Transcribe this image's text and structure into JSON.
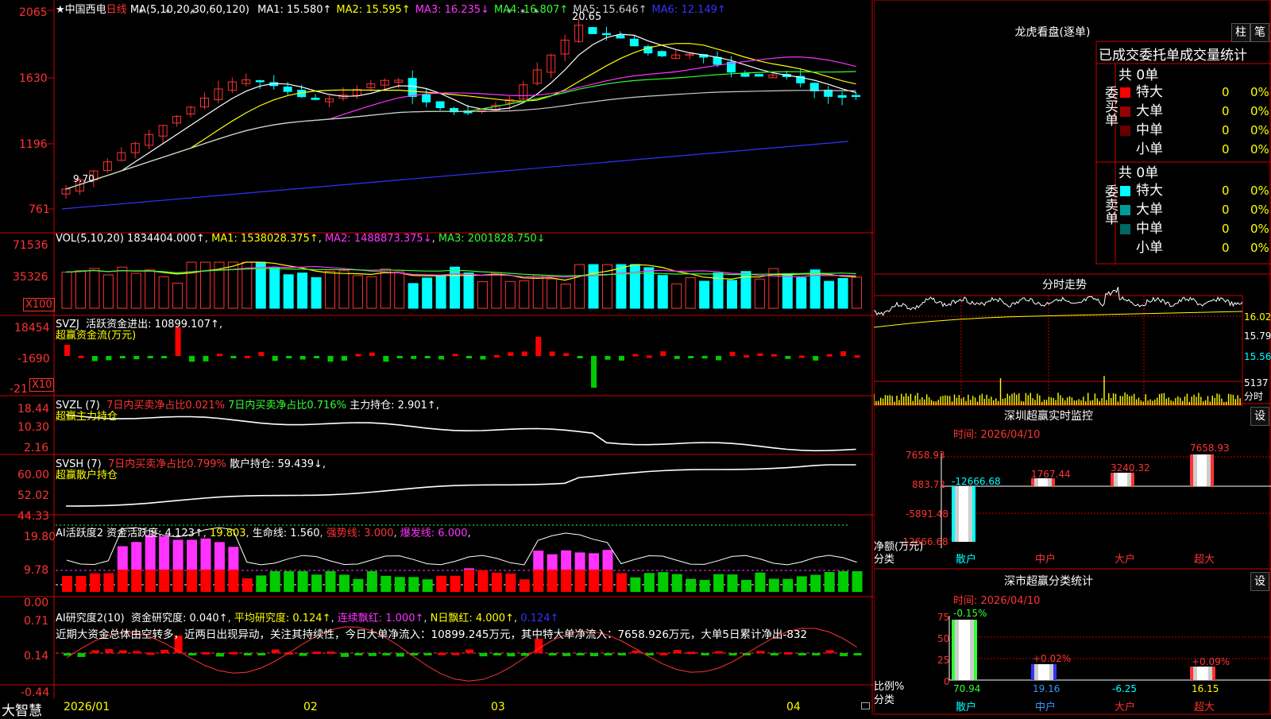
{
  "stock": {
    "star": "★",
    "name": "中国西电",
    "period": "日线",
    "ma_header": "MA(5,10,20,30,60,120)",
    "ma_values": [
      {
        "label": "MA1: 15.580↑",
        "color": "#ffffff"
      },
      {
        "label": "MA2: 15.595↑",
        "color": "#ffff00"
      },
      {
        "label": "MA3: 16.235↓",
        "color": "#ff33ff"
      },
      {
        "label": "MA4: 16.807↑",
        "color": "#33ff33"
      },
      {
        "label": "MA5: 15.646↑",
        "color": "#cccccc"
      },
      {
        "label": "MA6: 12.149↑",
        "color": "#3333ff"
      }
    ],
    "y_ticks": [
      "2065",
      "1630",
      "1196",
      "761"
    ],
    "high_label": "20.65",
    "low_label": "9.70",
    "x_dates": [
      "2026/01",
      "02",
      "03",
      "04"
    ]
  },
  "vol": {
    "header": "VOL(5,10,20)",
    "v1": "1834404.000↑",
    "v2": "MA1: 1538028.375↑",
    "v3": "MA2: 1488873.375↓",
    "v4": "MA3: 2001828.750↓",
    "y_ticks": [
      "71536",
      "35326"
    ],
    "unit": "X100"
  },
  "svzj": {
    "header": "SVZJ",
    "label1": "活跃资金进出: 10899.107↑,",
    "label2": "超赢资金流(万元)",
    "y_ticks": [
      "18454",
      "-1690",
      "-21"
    ],
    "unit": "X10"
  },
  "svzl": {
    "header": "SVZL (7)",
    "label1": "7日内买卖净占比0.021%",
    "label2": "7日内买卖净占比0.716%",
    "label3": "主力持仓: 2.901↑,",
    "label4": "超赢主力持仓",
    "y_ticks": [
      "18.44",
      "10.30",
      "2.16"
    ]
  },
  "svsh": {
    "header": "SVSH (7)",
    "label1": "7日内买卖净占比0.799%",
    "label2": "散户持仓: 59.439↓,",
    "label3": "超赢散户持仓",
    "y_ticks": [
      "60.00",
      "52.02",
      "44.33"
    ]
  },
  "ai1": {
    "header": "AI活跃度2",
    "label1": "资金活跃度: 4.123↑",
    "label2": "19.803",
    "label3": "生命线: 1.560",
    "label4": "强势线: 3.000",
    "label5": "爆发线: 6.000",
    "y_ticks": [
      "19.80",
      "9.78",
      "0.00"
    ]
  },
  "ai2": {
    "header": "AI研究度2(10)",
    "label1": "资金研究度: 0.040↑",
    "label2": "平均研究度: 0.124↑",
    "label3": "连续飘红: 1.000↑",
    "label4": "N日飘红: 4.000↑",
    "label5": "0.124↑",
    "comment": "近期大资金总体由空转多，近两日出现异动，关注其持续性，今日大单净流入：10899.245万元，其中特大单净流入：7658.926万元，大单5日累计净出-832",
    "y_ticks": [
      "0.71",
      "0.14",
      "-0.44"
    ]
  },
  "brand": "大智慧",
  "right": {
    "lhb_title": "龙虎看盘(逐单)",
    "btn_zhu": "柱",
    "btn_bi": "笔",
    "stats_title": "已成交委托单成交量统计",
    "buy_label": "委买单",
    "sell_label": "委卖单",
    "buy_total": "共 0单",
    "sell_total": "共 0单",
    "buy_rows": [
      {
        "name": "特大",
        "count": "0",
        "pct": "0%",
        "color": "#ff0000"
      },
      {
        "name": "大单",
        "count": "0",
        "pct": "0%",
        "color": "#990000"
      },
      {
        "name": "中单",
        "count": "0",
        "pct": "0%",
        "color": "#660000"
      },
      {
        "name": "小单",
        "count": "0",
        "pct": "0%",
        "color": "#000000"
      }
    ],
    "sell_rows": [
      {
        "name": "特大",
        "count": "0",
        "pct": "0%",
        "color": "#00ffff"
      },
      {
        "name": "大单",
        "count": "0",
        "pct": "0%",
        "color": "#009999"
      },
      {
        "name": "中单",
        "count": "0",
        "pct": "0%",
        "color": "#006666"
      },
      {
        "name": "小单",
        "count": "0",
        "pct": "0%",
        "color": "#000000"
      }
    ],
    "intraday_title": "分时走势",
    "intraday_ticks": [
      "16.02",
      "15.79",
      "15.56",
      "5137",
      "分时"
    ],
    "sz_title": "深圳超赢实时监控",
    "sz_btn": "设",
    "sz_time": "时间: 2026/04/10",
    "sz_ticks": [
      "7658.93",
      "883.72",
      "-5891.48",
      "-12666.68"
    ],
    "sz_bar_labels": [
      "-12666.68",
      "1767.44",
      "3240.32",
      "7658.93"
    ],
    "sz_ylabel": "净额(万元)",
    "sz_xlabel": "分类",
    "sz_cats": [
      "散户",
      "中户",
      "大户",
      "超大"
    ],
    "cls_title": "深市超赢分类统计",
    "cls_btn": "设",
    "cls_time": "时间: 2026/04/10",
    "cls_ticks": [
      "75",
      "50",
      "25",
      "0"
    ],
    "cls_pct_labels": [
      "-0.15%",
      "+0.02%",
      "",
      "+0.09%"
    ],
    "cls_values": [
      "70.94",
      "19.16",
      "-6.25",
      "16.15"
    ],
    "cls_ylabel": "比例%",
    "cls_xlabel": "分类",
    "cls_cats": [
      "散户",
      "中户",
      "大户",
      "超大"
    ]
  },
  "colors": {
    "up": "#ff3333",
    "down": "#00ffff",
    "frame": "#cc0000",
    "yellow": "#ffff00",
    "magenta": "#ff33ff",
    "green": "#33ff33"
  }
}
